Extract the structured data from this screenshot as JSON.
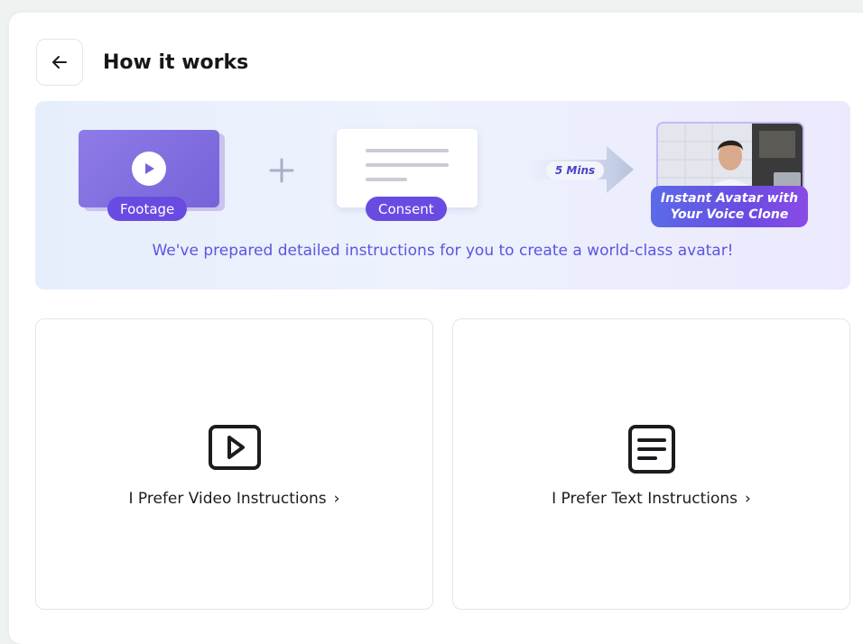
{
  "header": {
    "title": "How it works",
    "back_icon": "arrow-left-icon"
  },
  "banner": {
    "footage_label": "Footage",
    "consent_label": "Consent",
    "duration_label": "5 Mins",
    "avatar_label_line1": "Instant Avatar with",
    "avatar_label_line2": "Your Voice Clone",
    "caption": "We've prepared detailed instructions for you to create a world-class avatar!",
    "colors": {
      "accent": "#6a4be2",
      "caption": "#5b55e0",
      "footage_card": "#8f7be7"
    }
  },
  "options": [
    {
      "label": "I Prefer Video Instructions",
      "icon": "video-play-icon",
      "chevron": "›"
    },
    {
      "label": "I Prefer Text Instructions",
      "icon": "document-text-icon",
      "chevron": "›"
    }
  ]
}
